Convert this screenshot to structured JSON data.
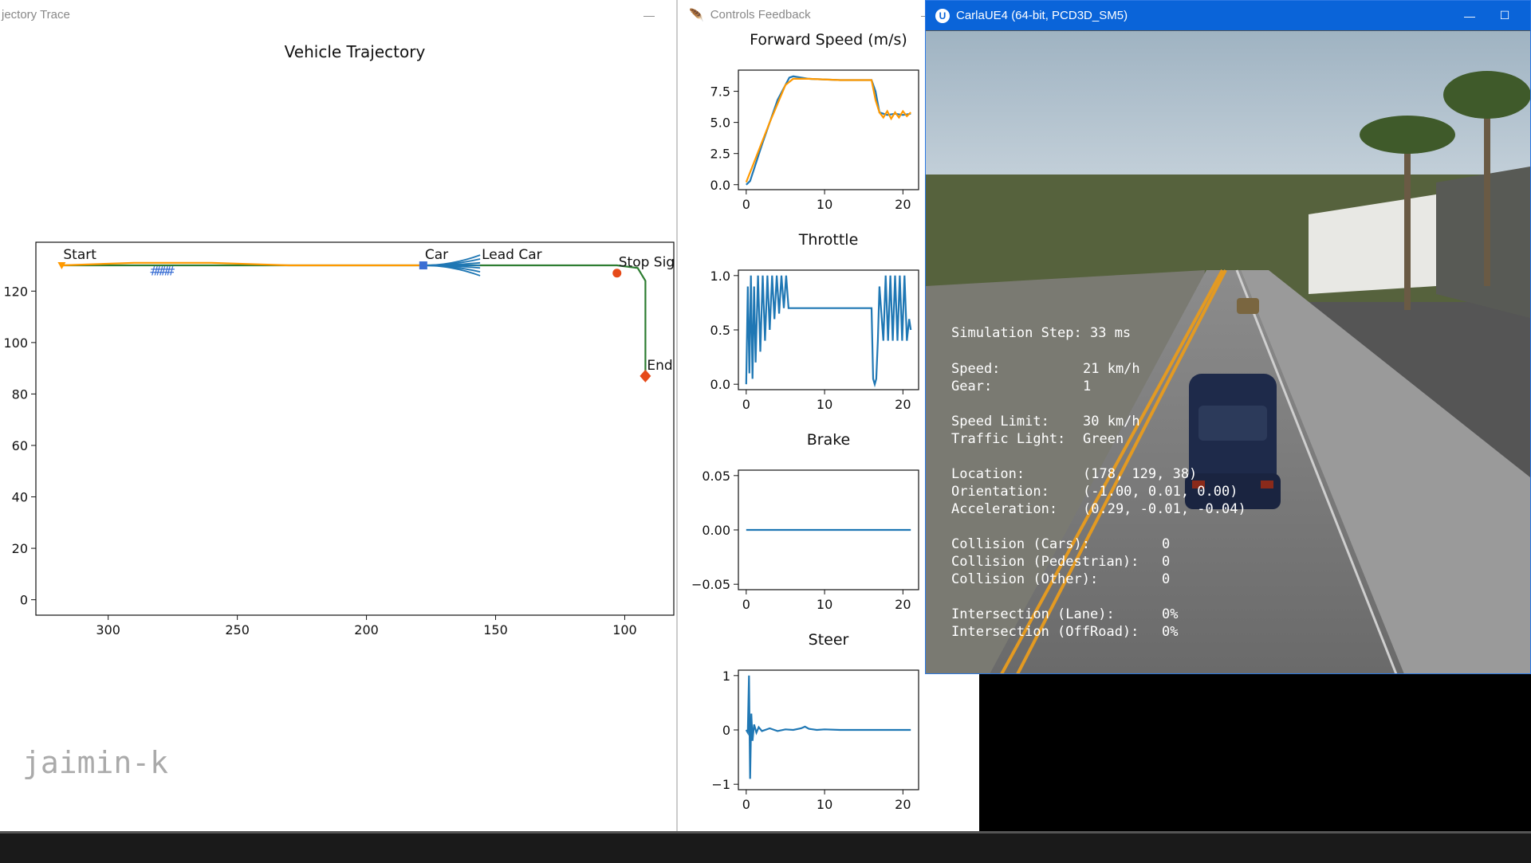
{
  "trajectory_window": {
    "title": "jectory Trace",
    "controls": {
      "minimize": "—"
    }
  },
  "controls_window": {
    "title": "Controls Feedback",
    "controls": {
      "minimize": "—",
      "maximize": "☐"
    }
  },
  "carla_window": {
    "title": "CarlaUE4 (64-bit, PCD3D_SM5)",
    "controls": {
      "minimize": "—",
      "maximize": "☐"
    },
    "hud": {
      "sim_step": "Simulation Step: 33 ms",
      "speed_label": "Speed:",
      "speed_value": "21 km/h",
      "gear_label": "Gear:",
      "gear_value": "1",
      "speed_limit_label": "Speed Limit:",
      "speed_limit_value": "30 km/h",
      "traffic_light_label": "Traffic Light:",
      "traffic_light_value": "Green",
      "location_label": "Location:",
      "location_value": "(178, 129, 38)",
      "orientation_label": "Orientation:",
      "orientation_value": "(-1.00, 0.01, 0.00)",
      "acceleration_label": "Acceleration:",
      "acceleration_value": "(0.29, -0.01, -0.04)",
      "coll_cars_label": "Collision (Cars):",
      "coll_cars_value": "0",
      "coll_ped_label": "Collision (Pedestrian):",
      "coll_ped_value": "0",
      "coll_other_label": "Collision (Other):",
      "coll_other_value": "0",
      "int_lane_label": "Intersection (Lane):",
      "int_lane_value": "0%",
      "int_offroad_label": "Intersection (OffRoad):",
      "int_offroad_value": "0%"
    }
  },
  "watermark": "jaimin-k",
  "colors": {
    "blue": "#1f77b4",
    "orange": "#ff9900",
    "green": "#2e7d32",
    "red": "#e64a19",
    "title_accent": "#0a64d9"
  },
  "chart_data": [
    {
      "type": "line",
      "title": "Vehicle Trajectory",
      "x_ticks": [
        300,
        250,
        200,
        150,
        100
      ],
      "y_ticks": [
        120,
        100,
        80,
        60,
        40,
        20,
        0
      ],
      "xlim": [
        328,
        81
      ],
      "ylim": [
        -6,
        139
      ],
      "x_inverted": true,
      "annotations": [
        {
          "text": "Start",
          "x": 318,
          "y": 130
        },
        {
          "text": "Car",
          "x": 178,
          "y": 130
        },
        {
          "text": "Lead Car",
          "x": 156,
          "y": 130
        },
        {
          "text": "Stop Sig",
          "x": 103,
          "y": 127
        },
        {
          "text": "End",
          "x": 92,
          "y": 87
        }
      ],
      "series": [
        {
          "color": "#2e7d32",
          "x": [
            318,
            280,
            230,
            178,
            150,
            120,
            103,
            95,
            92,
            92,
            92
          ],
          "y": [
            130,
            130,
            130,
            130,
            130,
            130,
            130,
            129,
            124,
            110,
            87
          ]
        },
        {
          "color": "#ff9900",
          "x": [
            318,
            290,
            260,
            230,
            200,
            178
          ],
          "y": [
            130,
            131,
            131,
            130,
            130,
            130
          ]
        }
      ],
      "markers": [
        {
          "label": "Start",
          "x": 318,
          "y": 130,
          "color": "#ff9900",
          "shape": "triangle"
        },
        {
          "label": "Car",
          "x": 178,
          "y": 130,
          "color": "#3b6fd4",
          "shape": "square"
        },
        {
          "label": "Stop Sig",
          "x": 103,
          "y": 127,
          "color": "#e64a19",
          "shape": "circle"
        },
        {
          "label": "End",
          "x": 92,
          "y": 87,
          "color": "#e64a19",
          "shape": "diamond"
        }
      ],
      "waypoint_marks_x": [
        282,
        280,
        278,
        276
      ],
      "waypoint_marks_y": 128,
      "fan_end_x": 156,
      "fan_origin_x": 178,
      "fan_y_offsets": [
        -4,
        -2.5,
        -1,
        0,
        1,
        2.5,
        4
      ]
    },
    {
      "type": "line",
      "title": "Forward Speed (m/s)",
      "x_ticks": [
        0,
        10,
        20
      ],
      "y_ticks": [
        0.0,
        2.5,
        5.0,
        7.5
      ],
      "y_tick_labels": [
        "0.0",
        "2.5",
        "5.0",
        "7.5"
      ],
      "xlim": [
        -1,
        22
      ],
      "ylim": [
        -0.4,
        9.2
      ],
      "series": [
        {
          "color": "#1f77b4",
          "x": [
            0,
            0.5,
            2,
            4,
            5.5,
            6,
            8,
            12,
            16,
            16.5,
            17,
            17.5,
            18,
            19,
            20,
            21
          ],
          "y": [
            0,
            0.3,
            3.2,
            6.8,
            8.6,
            8.7,
            8.5,
            8.4,
            8.4,
            7.5,
            5.8,
            5.7,
            5.6,
            5.7,
            5.6,
            5.7
          ]
        },
        {
          "color": "#ff9900",
          "x": [
            0,
            1,
            3,
            5,
            6,
            8,
            12,
            16,
            16.5,
            17,
            17.5,
            18,
            18.5,
            19,
            19.5,
            20,
            20.5,
            21
          ],
          "y": [
            0.2,
            1.8,
            5.0,
            8.0,
            8.5,
            8.5,
            8.4,
            8.4,
            6.8,
            5.8,
            5.4,
            5.9,
            5.3,
            5.8,
            5.4,
            5.9,
            5.5,
            5.8
          ]
        }
      ]
    },
    {
      "type": "line",
      "title": "Throttle",
      "x_ticks": [
        0,
        10,
        20
      ],
      "y_ticks": [
        0.0,
        0.5,
        1.0
      ],
      "y_tick_labels": [
        "0.0",
        "0.5",
        "1.0"
      ],
      "xlim": [
        -1,
        22
      ],
      "ylim": [
        -0.05,
        1.05
      ],
      "series": [
        {
          "color": "#1f77b4",
          "x": [
            0,
            0.2,
            0.4,
            0.6,
            0.8,
            1.0,
            1.2,
            1.5,
            1.8,
            2.1,
            2.4,
            2.7,
            3.0,
            3.3,
            3.6,
            3.9,
            4.2,
            4.5,
            4.8,
            5.1,
            5.4,
            5.6,
            16,
            16.2,
            16.4,
            16.6,
            16.8,
            17.0,
            17.5,
            17.8,
            18.1,
            18.4,
            18.7,
            19.0,
            19.3,
            19.6,
            19.9,
            20.2,
            20.5,
            20.8,
            21
          ],
          "y": [
            0.0,
            0.9,
            0.1,
            1.0,
            0.05,
            0.9,
            0.2,
            1.0,
            0.3,
            1.0,
            0.4,
            1.0,
            0.5,
            1.0,
            0.6,
            1.0,
            0.65,
            1.0,
            0.7,
            1.0,
            0.7,
            0.7,
            0.7,
            0.05,
            0.0,
            0.05,
            0.4,
            0.9,
            0.4,
            1.0,
            0.4,
            1.0,
            0.4,
            1.0,
            0.4,
            1.0,
            0.4,
            1.0,
            0.4,
            0.6,
            0.5
          ]
        }
      ]
    },
    {
      "type": "line",
      "title": "Brake",
      "x_ticks": [
        0,
        10,
        20
      ],
      "y_ticks": [
        0.05,
        0.0,
        -0.05
      ],
      "y_tick_labels": [
        "0.05",
        "0.00",
        "−0.05"
      ],
      "xlim": [
        -1,
        22
      ],
      "ylim": [
        -0.055,
        0.055
      ],
      "series": [
        {
          "color": "#1f77b4",
          "x": [
            0,
            21
          ],
          "y": [
            0,
            0
          ]
        }
      ]
    },
    {
      "type": "line",
      "title": "Steer",
      "x_ticks": [
        0,
        10,
        20
      ],
      "y_ticks": [
        1,
        0,
        -1
      ],
      "y_tick_labels": [
        "1",
        "0",
        "−1"
      ],
      "xlim": [
        -1,
        22
      ],
      "ylim": [
        -1.1,
        1.1
      ],
      "series": [
        {
          "color": "#1f77b4",
          "x": [
            0,
            0.2,
            0.35,
            0.5,
            0.65,
            0.8,
            1.0,
            1.3,
            1.6,
            2.0,
            3,
            4,
            5,
            6,
            7,
            7.5,
            8,
            9,
            10,
            12,
            14,
            16,
            18,
            20,
            21
          ],
          "y": [
            0,
            -0.05,
            1.0,
            -0.9,
            0.3,
            -0.2,
            0.1,
            -0.05,
            0.05,
            -0.02,
            0.03,
            -0.02,
            0.01,
            0.0,
            0.03,
            0.06,
            0.02,
            0.0,
            0.01,
            0.0,
            0.0,
            0.0,
            0.0,
            0.0,
            0.0
          ]
        }
      ]
    }
  ]
}
